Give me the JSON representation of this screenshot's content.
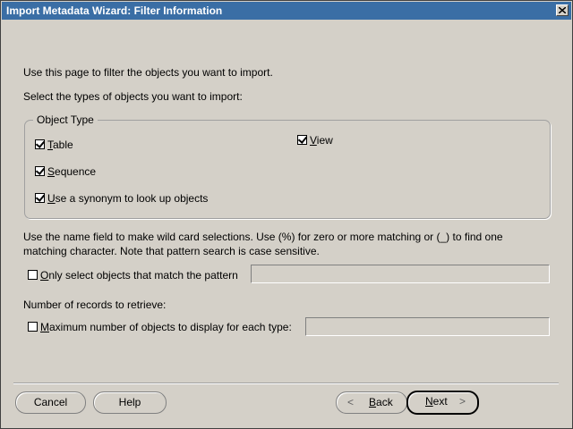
{
  "window": {
    "title": "Import Metadata Wizard: Filter Information"
  },
  "intro": {
    "line1": "Use this page to filter the objects you want to import.",
    "line2": "Select the types of objects you want to import:"
  },
  "object_type": {
    "legend": "Object Type",
    "table": {
      "mnemonic": "T",
      "rest": "able",
      "checked": true
    },
    "view": {
      "mnemonic": "V",
      "rest": "iew",
      "checked": true
    },
    "sequence": {
      "mnemonic": "S",
      "rest": "equence",
      "checked": true
    },
    "synonym": {
      "mnemonic": "U",
      "rest": "se a synonym to look up objects",
      "checked": true
    }
  },
  "pattern": {
    "help_line1": "Use the name field to make wild card selections. Use (%) for zero or more matching or (_) to find one",
    "help_line2": "matching character. Note that pattern search is case sensitive.",
    "checkbox": {
      "mnemonic": "O",
      "rest": "nly select objects that match the pattern",
      "checked": false
    },
    "value": ""
  },
  "records": {
    "label": "Number of records to retrieve:",
    "checkbox": {
      "mnemonic": "M",
      "rest": "aximum number of objects to display for each type:",
      "checked": false
    },
    "value": ""
  },
  "buttons": {
    "cancel": "Cancel",
    "help": "Help",
    "back_mnemonic": "B",
    "back_rest": "ack",
    "next_mnemonic": "N",
    "next_rest": "ext"
  }
}
